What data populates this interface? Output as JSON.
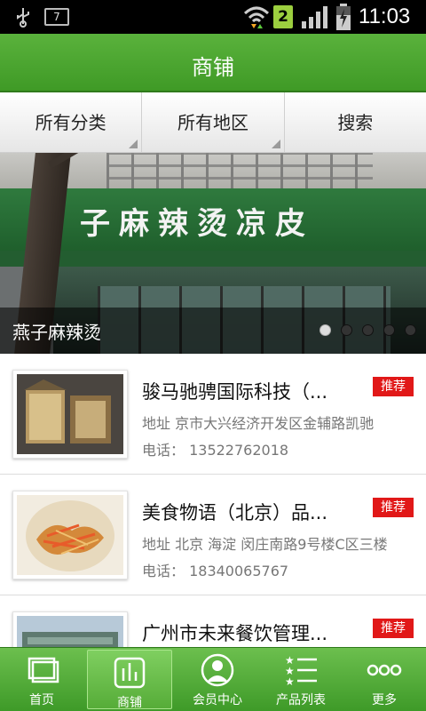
{
  "status_bar": {
    "notification_count": "7",
    "sim_slot": "2",
    "time": "11:03"
  },
  "header": {
    "title": "商铺"
  },
  "filters": [
    {
      "label": "所有分类"
    },
    {
      "label": "所有地区"
    },
    {
      "label": "搜索"
    }
  ],
  "banner": {
    "caption": "燕子麻辣烫",
    "sign_text": "子麻辣烫凉皮",
    "slide_count": 5,
    "active_slide": 1
  },
  "shops": [
    {
      "name": "骏马驰骋国际科技（...",
      "badge": "推荐",
      "address": "地址  京市大兴经济开发区金辅路凯驰",
      "phone": "电话：  13522762018"
    },
    {
      "name": "美食物语（北京）品...",
      "badge": "推荐",
      "address": "地址  北京 海淀 闵庄南路9号楼C区三楼",
      "phone": "电话：  18340065767"
    },
    {
      "name": "广州市未来餐饮管理...",
      "badge": "推荐",
      "address": "",
      "phone": ""
    }
  ],
  "bottom_nav": [
    {
      "label": "首页",
      "icon": "home-icon"
    },
    {
      "label": "商铺",
      "icon": "shop-icon",
      "active": true
    },
    {
      "label": "会员中心",
      "icon": "user-icon"
    },
    {
      "label": "产品列表",
      "icon": "list-icon"
    },
    {
      "label": "更多",
      "icon": "more-icon"
    }
  ],
  "colors": {
    "brand_green": "#4caf33",
    "badge_red": "#e11818"
  }
}
